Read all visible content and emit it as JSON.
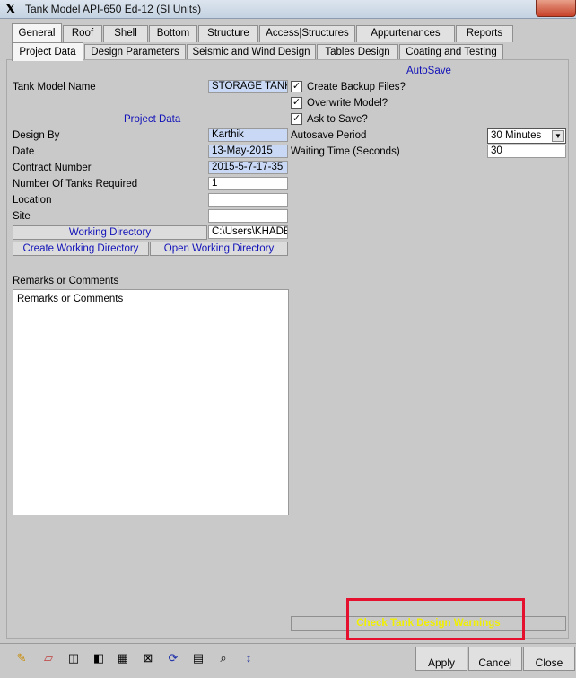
{
  "window": {
    "title": "Tank Model API-650 Ed-12 (SI Units)"
  },
  "main_tabs": [
    "General",
    "Roof",
    "Shell",
    "Bottom",
    "Structure",
    "Access|Structures",
    "Appurtenances",
    "Reports"
  ],
  "sub_tabs": [
    "Project Data",
    "Design Parameters",
    "Seismic and Wind Design",
    "Tables Design",
    "Coating and Testing"
  ],
  "autosave_header": "AutoSave",
  "project_data_header": "Project Data",
  "tank_model": {
    "label": "Tank Model Name",
    "value": "STORAGE TANK"
  },
  "design_by": {
    "label": "Design By",
    "value": "Karthik"
  },
  "date": {
    "label": "Date",
    "value": "13-May-2015"
  },
  "contract_number": {
    "label": "Contract Number",
    "value": "2015-5-7-17-35"
  },
  "num_tanks": {
    "label": "Number Of Tanks Required",
    "value": "1"
  },
  "location": {
    "label": "Location",
    "value": ""
  },
  "site": {
    "label": "Site",
    "value": ""
  },
  "working_directory": {
    "button": "Working Directory",
    "value": "C:\\Users\\KHADE"
  },
  "create_dir_button": "Create Working Directory",
  "open_dir_button": "Open Working Directory",
  "checks": [
    {
      "label": "Create Backup Files?",
      "checked": true
    },
    {
      "label": "Overwrite Model?",
      "checked": true
    },
    {
      "label": "Ask to Save?",
      "checked": true
    }
  ],
  "autosave_period": {
    "label": "Autosave Period",
    "value": "30 Minutes"
  },
  "waiting_time": {
    "label": "Waiting Time (Seconds)",
    "value": "30"
  },
  "remarks": {
    "label": "Remarks or Comments",
    "value": "Remarks or Comments"
  },
  "check_warnings_button": "Check Tank Design Warnings",
  "footer": {
    "apply": "Apply",
    "cancel": "Cancel",
    "close": "Close"
  },
  "toolbar_icons": [
    "pencil-icon",
    "eraser-icon",
    "columns-icon",
    "dark-columns-icon",
    "grid-icon",
    "refresh-icon",
    "notes-icon",
    "search-icon",
    "resize-vertical-icon"
  ]
}
